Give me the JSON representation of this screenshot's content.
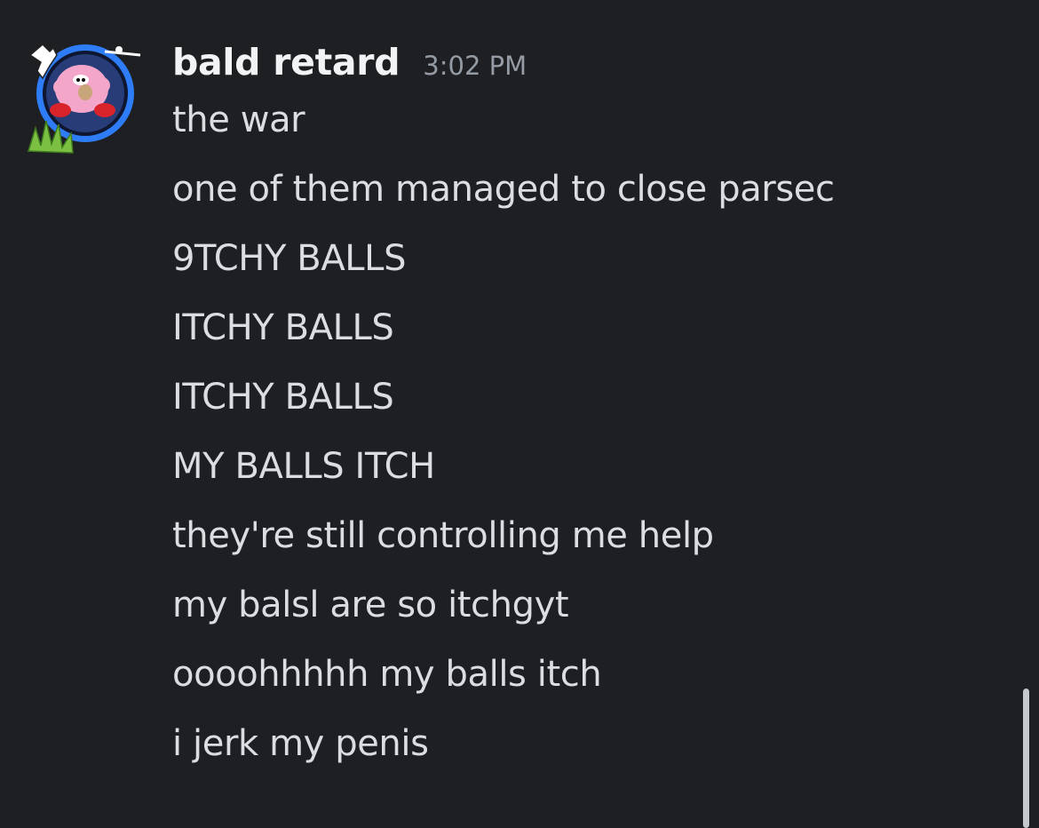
{
  "message_group": {
    "author": "bald retard",
    "timestamp": "3:02 PM",
    "avatar_icon": "kirby-avatar-with-grass-and-pointing-hand",
    "messages": [
      "the war",
      "one of them managed to close parsec",
      "9TCHY BALLS",
      "ITCHY BALLS",
      "ITCHY BALLS",
      "MY BALLS ITCH",
      "they're still controlling me help",
      "my balsl are so itchgyt",
      "oooohhhhh my balls itch",
      "i jerk my penis"
    ]
  },
  "colors": {
    "background": "#1e1f22",
    "username": "#f2f3f5",
    "message_text": "#dbdee1",
    "timestamp": "#949ba4",
    "avatar_ring": "#2f7df6"
  }
}
